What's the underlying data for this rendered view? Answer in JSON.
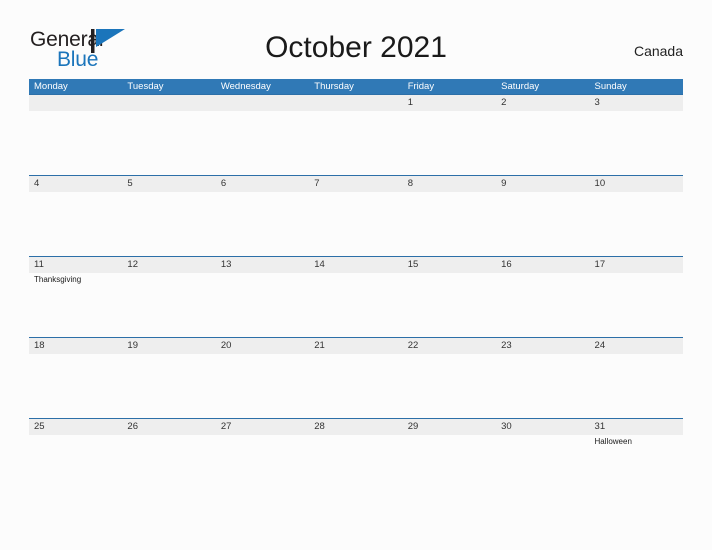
{
  "brand": {
    "name_part1": "General",
    "name_part2": "Blue",
    "logo_icon": "flag-triangle-icon",
    "accent_color": "#1b75bb"
  },
  "header": {
    "title": "October 2021",
    "region": "Canada"
  },
  "theme": {
    "header_blue": "#3079b6",
    "rule_blue": "#2c6fa8",
    "band_gray": "#eeeeee",
    "page_background": "#fcfcfc"
  },
  "calendar": {
    "month": "October",
    "year": "2021",
    "weekday_headers": [
      "Monday",
      "Tuesday",
      "Wednesday",
      "Thursday",
      "Friday",
      "Saturday",
      "Sunday"
    ],
    "weeks": [
      {
        "days": [
          {
            "date": "",
            "event": ""
          },
          {
            "date": "",
            "event": ""
          },
          {
            "date": "",
            "event": ""
          },
          {
            "date": "",
            "event": ""
          },
          {
            "date": "1",
            "event": ""
          },
          {
            "date": "2",
            "event": ""
          },
          {
            "date": "3",
            "event": ""
          }
        ]
      },
      {
        "days": [
          {
            "date": "4",
            "event": ""
          },
          {
            "date": "5",
            "event": ""
          },
          {
            "date": "6",
            "event": ""
          },
          {
            "date": "7",
            "event": ""
          },
          {
            "date": "8",
            "event": ""
          },
          {
            "date": "9",
            "event": ""
          },
          {
            "date": "10",
            "event": ""
          }
        ]
      },
      {
        "days": [
          {
            "date": "11",
            "event": "Thanksgiving"
          },
          {
            "date": "12",
            "event": ""
          },
          {
            "date": "13",
            "event": ""
          },
          {
            "date": "14",
            "event": ""
          },
          {
            "date": "15",
            "event": ""
          },
          {
            "date": "16",
            "event": ""
          },
          {
            "date": "17",
            "event": ""
          }
        ]
      },
      {
        "days": [
          {
            "date": "18",
            "event": ""
          },
          {
            "date": "19",
            "event": ""
          },
          {
            "date": "20",
            "event": ""
          },
          {
            "date": "21",
            "event": ""
          },
          {
            "date": "22",
            "event": ""
          },
          {
            "date": "23",
            "event": ""
          },
          {
            "date": "24",
            "event": ""
          }
        ]
      },
      {
        "days": [
          {
            "date": "25",
            "event": ""
          },
          {
            "date": "26",
            "event": ""
          },
          {
            "date": "27",
            "event": ""
          },
          {
            "date": "28",
            "event": ""
          },
          {
            "date": "29",
            "event": ""
          },
          {
            "date": "30",
            "event": ""
          },
          {
            "date": "31",
            "event": "Halloween"
          }
        ]
      }
    ]
  }
}
